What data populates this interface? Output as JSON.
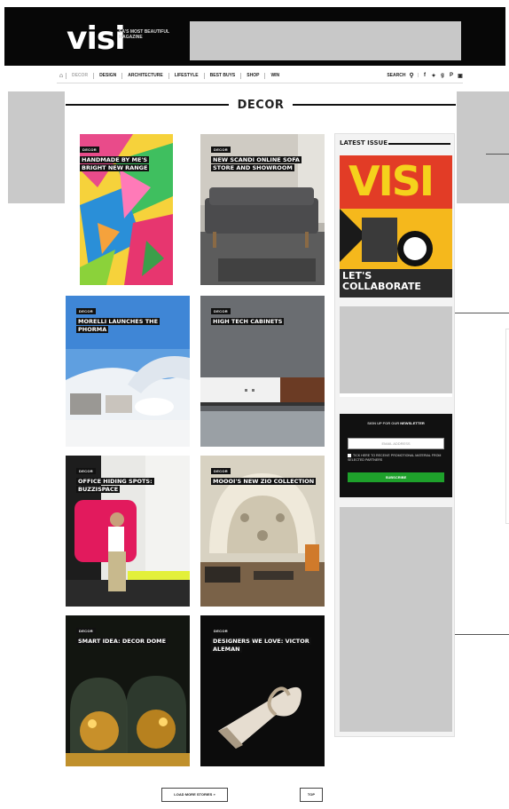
{
  "header": {
    "logo": "visi",
    "tagline": "SA'S MOST BEAUTIFUL MAGAZINE"
  },
  "nav": {
    "items": [
      "DECOR",
      "DESIGN",
      "ARCHITECTURE",
      "LIFESTYLE",
      "BEST BUYS",
      "SHOP",
      "WIN"
    ],
    "active": "DECOR",
    "search_label": "SEARCH",
    "social_icons": [
      "facebook-icon",
      "twitter-icon",
      "google-plus-icon",
      "pinterest-icon",
      "instagram-icon"
    ]
  },
  "section": {
    "title": "DECOR"
  },
  "articles": [
    {
      "tag": "DECOR",
      "title": "HANDMADE BY ME'S BRIGHT NEW RANGE"
    },
    {
      "tag": "DECOR",
      "title": "NEW SCANDI ONLINE SOFA STORE AND SHOWROOM"
    },
    {
      "tag": "DECOR",
      "title": "MORELLI LAUNCHES THE PHORMA"
    },
    {
      "tag": "DECOR",
      "title": "HIGH TECH CABINETS"
    },
    {
      "tag": "DECOR",
      "title": "OFFICE HIDING SPOTS: BUZZISPACE"
    },
    {
      "tag": "DECOR",
      "title": "MOOOI'S NEW ZIO COLLECTION"
    },
    {
      "tag": "DECOR",
      "title": "SMART IDEA: DECOR DOME"
    },
    {
      "tag": "DECOR",
      "title": "DESIGNERS WE LOVE: VICTOR ALEMAN"
    }
  ],
  "sidebar": {
    "latest_issue_label": "LATEST ISSUE",
    "cover": {
      "logo": "VISI",
      "headline": "LET'S COLLABORATE"
    },
    "newsletter": {
      "title_prefix": "SIGN UP FOR OUR",
      "title_strong": "NEWSLETTER",
      "email_placeholder": "EMAIL ADDRESS",
      "checkbox_label": "TICK HERE TO RECEIVE PROMOTIONAL MATERIAL FROM SELECTED PARTNERS",
      "button_label": "SUBSCRIBE"
    }
  },
  "pagination": {
    "load_more_label": "LOAD MORE STORIES »",
    "top_label": "TOP"
  }
}
